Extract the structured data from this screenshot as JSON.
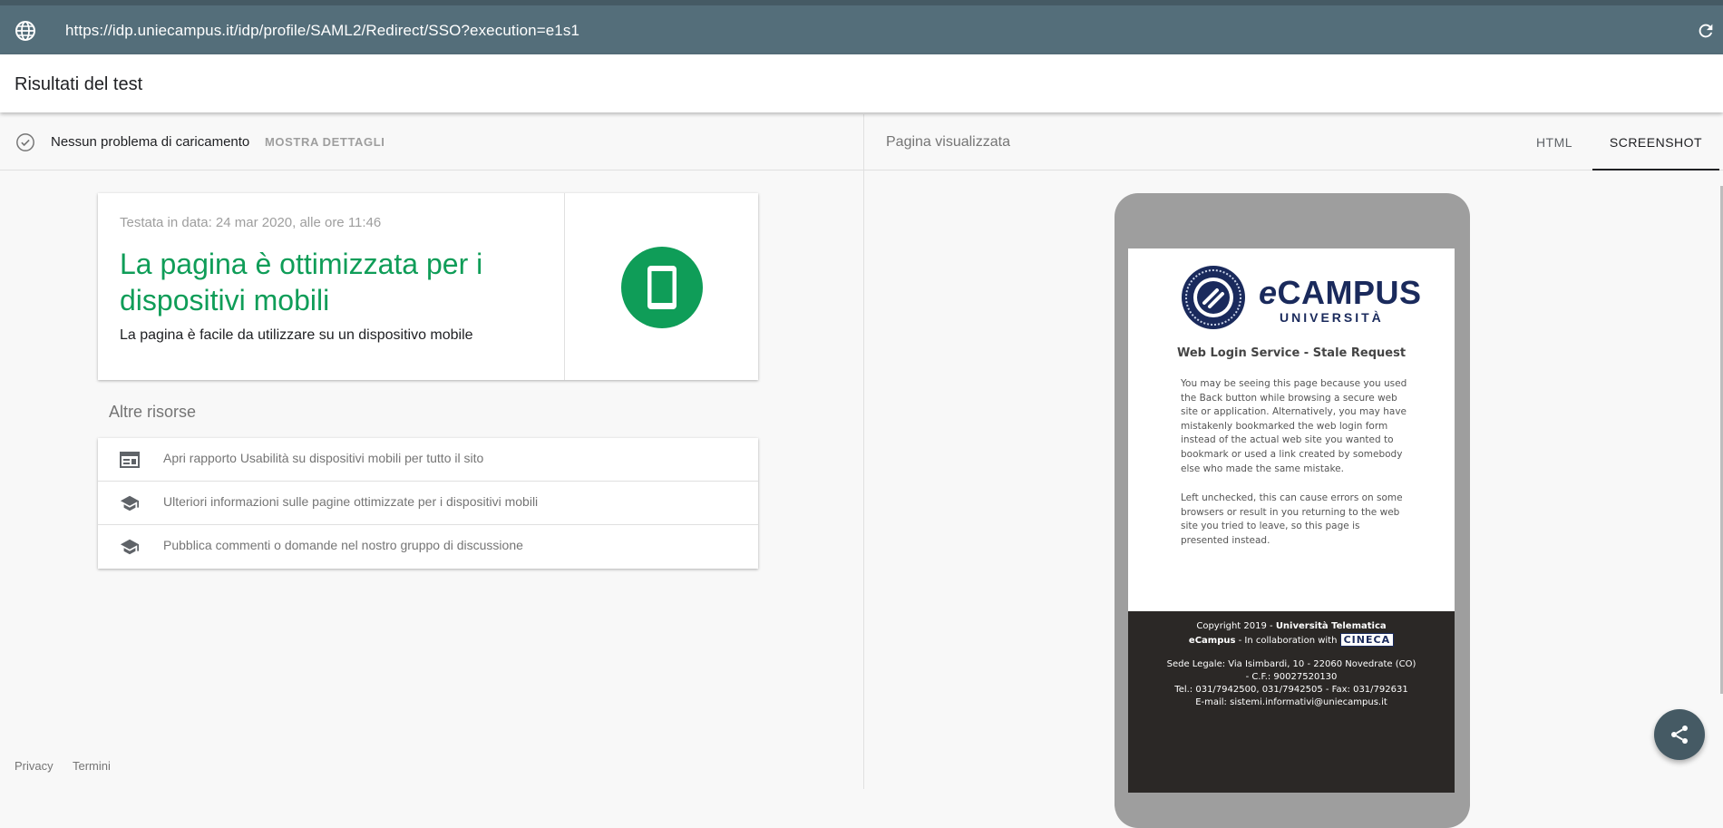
{
  "browser": {
    "url": "https://idp.uniecampus.it/idp/profile/SAML2/Redirect/SSO?execution=e1s1"
  },
  "header": {
    "title": "Risultati del test"
  },
  "left_panel": {
    "status": "Nessun problema di caricamento",
    "details_button": "MOSTRA DETTAGLI",
    "result": {
      "date": "Testata in data: 24 mar 2020, alle ore 11:46",
      "headline": "La pagina è ottimizzata per i dispositivi mobili",
      "subtitle": "La pagina è facile da utilizzare su un dispositivo mobile",
      "success_color": "#0f9d58"
    },
    "resources_title": "Altre risorse",
    "resources": [
      {
        "icon": "web-report-icon",
        "label": "Apri rapporto Usabilità su dispositivi mobili per tutto il sito"
      },
      {
        "icon": "school-icon",
        "label": "Ulteriori informazioni sulle pagine ottimizzate per i dispositivi mobili"
      },
      {
        "icon": "school-icon",
        "label": "Pubblica commenti o domande nel nostro gruppo di discussione"
      }
    ]
  },
  "right_panel": {
    "label": "Pagina visualizzata",
    "tabs": [
      {
        "label": "HTML",
        "active": false
      },
      {
        "label": "SCREENSHOT",
        "active": true
      }
    ],
    "preview": {
      "brand": "CAMPUS",
      "brand_prefix": "e",
      "brand_sub": "UNIVERSITÀ",
      "title": "Web Login Service - Stale Request",
      "para1": "You may be seeing this page because you used the Back button while browsing a secure web site or application. Alternatively, you may have mistakenly bookmarked the web login form instead of the actual web site you wanted to bookmark or used a link created by somebody else who made the same mistake.",
      "para2": "Left unchecked, this can cause errors on some browsers or result in you returning to the web site you tried to leave, so this page is presented instead.",
      "footer_copyright_prefix": "Copyright 2019 - ",
      "footer_university": "Università Telematica",
      "footer_ecampus": "eCampus",
      "footer_collab": " - In collaboration with ",
      "footer_cineca": "CINECA",
      "footer_address": "Sede Legale: Via Isimbardi, 10 - 22060 Novedrate (CO) - C.F.: 90027520130",
      "footer_tel": "Tel.: 031/7942500, 031/7942505 - Fax: 031/792631",
      "footer_email": "E-mail: sistemi.informativi@uniecampus.it"
    }
  },
  "footer": {
    "privacy": "Privacy",
    "terms": "Termini"
  },
  "colors": {
    "urlbar": "#546e7a",
    "fab": "#455a64",
    "brand_navy": "#1a2a5c"
  }
}
